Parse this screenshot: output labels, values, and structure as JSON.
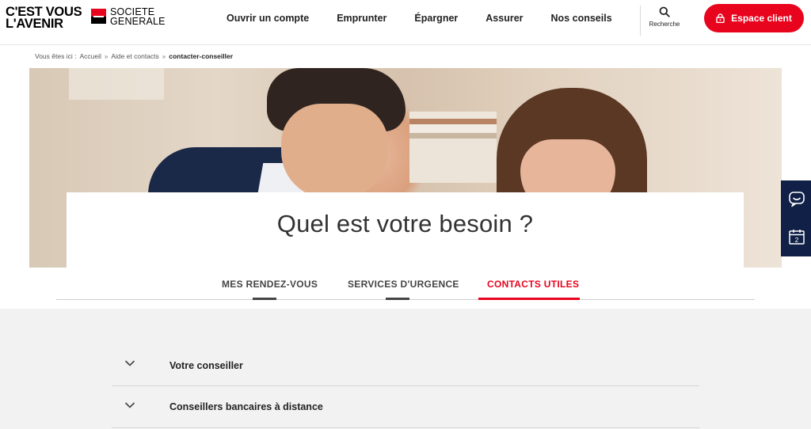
{
  "header": {
    "slogan_line1": "C'EST VOUS",
    "slogan_line2": "L'AVENIR",
    "brand_line1": "SOCIETE",
    "brand_line2": "GENERALE",
    "nav": [
      "Ouvrir un compte",
      "Emprunter",
      "Épargner",
      "Assurer",
      "Nos conseils"
    ],
    "search_label": "Recherche",
    "espace_client_label": "Espace client",
    "brand_colors": {
      "red": "#e9041e",
      "black": "#000000",
      "navy": "#102046"
    }
  },
  "breadcrumb": {
    "prefix": "Vous êtes ici :",
    "items": [
      "Accueil",
      "Aide et contacts"
    ],
    "current": "contacter-conseiller"
  },
  "hero": {
    "title": "Quel est votre besoin ?"
  },
  "side_bar": {
    "icons": [
      "chat-icon",
      "calendar-icon"
    ],
    "calendar_number": "2"
  },
  "tabs": [
    {
      "label": "MES RENDEZ-VOUS",
      "active": false
    },
    {
      "label": "SERVICES D'URGENCE",
      "active": false
    },
    {
      "label": "CONTACTS UTILES",
      "active": true
    }
  ],
  "accordion": [
    {
      "label": "Votre conseiller"
    },
    {
      "label": "Conseillers bancaires à distance"
    }
  ]
}
